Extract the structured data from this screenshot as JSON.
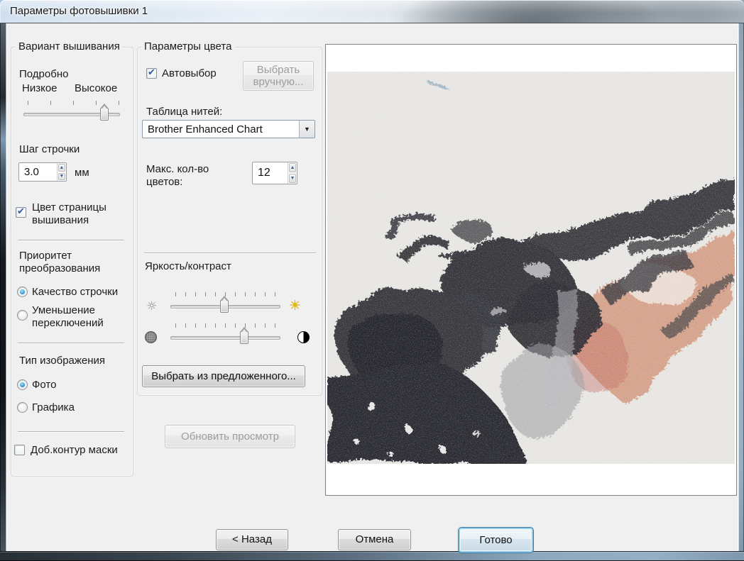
{
  "window": {
    "title": "Параметры фотовышивки 1"
  },
  "left": {
    "group_label": "Вариант вышивания",
    "detail": {
      "label": "Подробно",
      "low": "Низкое",
      "high": "Высокое",
      "value_percent": 85,
      "ticks": 5
    },
    "stitch": {
      "label": "Шаг строчки",
      "value": "3.0",
      "unit": "мм"
    },
    "page_color": {
      "label": "Цвет страницы вышивания",
      "checked": true
    },
    "priority": {
      "label": "Приоритет преобразования",
      "options": [
        {
          "label": "Качество строчки",
          "selected": true
        },
        {
          "label": "Уменьшение переключений",
          "selected": false
        }
      ]
    },
    "image_type": {
      "label": "Тип изображения",
      "options": [
        {
          "label": "Фото",
          "selected": true
        },
        {
          "label": "Графика",
          "selected": false
        }
      ]
    },
    "mask": {
      "label": "Доб.контур маски",
      "checked": false
    }
  },
  "color": {
    "group_label": "Параметры цвета",
    "auto": {
      "label": "Автовыбор",
      "checked": true
    },
    "manual": {
      "label": "Выбрать вручную...",
      "enabled": false
    },
    "thread": {
      "label": "Таблица нитей:",
      "value": "Brother Enhanced Chart"
    },
    "max_colors": {
      "label": "Макс. кол-во цветов:",
      "value": "12"
    },
    "bc_label": "Яркость/контраст",
    "brightness": {
      "percent": 47,
      "ticks": 11
    },
    "contrast": {
      "percent": 63,
      "ticks": 11
    },
    "candidates": {
      "label": "Выбрать из предложенного...",
      "enabled": true
    },
    "update": {
      "label": "Обновить просмотр",
      "enabled": false
    }
  },
  "footer": {
    "back": {
      "label": "< Назад"
    },
    "cancel": {
      "label": "Отмена"
    },
    "finish": {
      "label": "Готово",
      "default": true
    }
  },
  "icons": {
    "spin_up": "▲",
    "spin_down": "▼",
    "dropdown_arrow": "▼",
    "sun_dim": "☼",
    "sun_bright": "☀",
    "check": "✔"
  },
  "colors": {
    "dialog_bg": "#f0f0f0",
    "titlebar_tint": "#dce7f2",
    "default_button_glow": "#8ecaea",
    "accent_check": "#2d5e9d",
    "radio_dot": "#3f9ed1",
    "preview_bg": "#e8e6e3",
    "skin_tone": "#d5a28b",
    "stitch_dark": "#35353b"
  }
}
